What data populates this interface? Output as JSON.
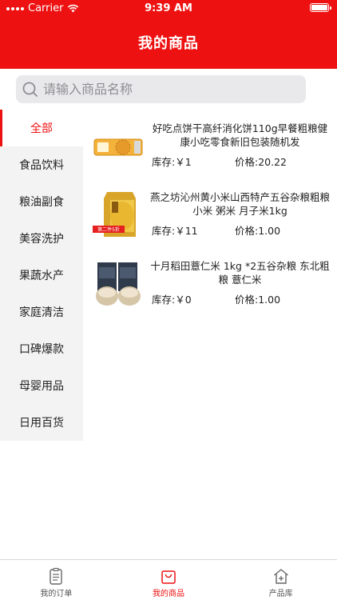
{
  "status": {
    "carrier": "Carrier",
    "time": "9:39 AM"
  },
  "nav": {
    "title": "我的商品"
  },
  "search": {
    "placeholder": "请输入商品名称"
  },
  "categories": [
    {
      "label": "全部",
      "active": true
    },
    {
      "label": "食品饮料"
    },
    {
      "label": "粮油副食"
    },
    {
      "label": "美容洗护"
    },
    {
      "label": "果蔬水产"
    },
    {
      "label": "家庭清洁"
    },
    {
      "label": "口碑爆款"
    },
    {
      "label": "母婴用品"
    },
    {
      "label": "日用百货"
    }
  ],
  "products": [
    {
      "name": "好吃点饼干高纤消化饼110g早餐粗粮健康小吃零食新旧包装随机发",
      "stock": "库存:￥1",
      "price": "价格:20.22"
    },
    {
      "name": "燕之坊沁州黄小米山西特产五谷杂粮粗粮 小米 粥米 月子米1kg",
      "stock": "库存:￥11",
      "price": "价格:1.00",
      "badge": "第二件5折"
    },
    {
      "name": "十月稻田薏仁米 1kg *2五谷杂粮 东北粗粮 薏仁米",
      "stock": "库存:￥0",
      "price": "价格:1.00"
    }
  ],
  "tabs": [
    {
      "label": "我的订单",
      "icon": "clipboard-icon"
    },
    {
      "label": "我的商品",
      "icon": "bag-icon",
      "active": true
    },
    {
      "label": "产品库",
      "icon": "house-icon"
    }
  ],
  "colors": {
    "accent": "#ee1111",
    "sidebar_bg": "#f3f3f3",
    "search_bg": "#e9e9eb"
  }
}
